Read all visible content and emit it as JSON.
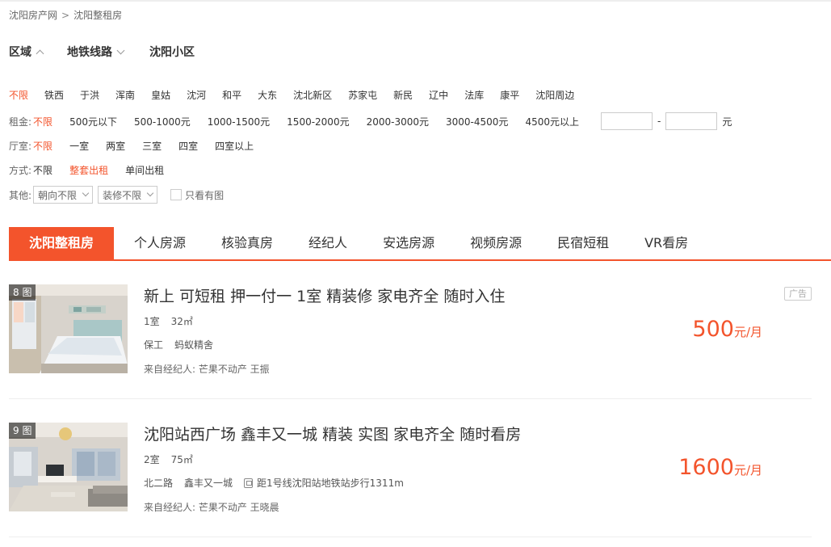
{
  "breadcrumb": {
    "home": "沈阳房产网",
    "sep": ">",
    "current": "沈阳整租房"
  },
  "search_tabs": [
    "区域",
    "地铁线路",
    "沈阳小区"
  ],
  "filters": {
    "region_options": [
      "不限",
      "铁西",
      "于洪",
      "浑南",
      "皇姑",
      "沈河",
      "和平",
      "大东",
      "沈北新区",
      "苏家屯",
      "新民",
      "辽中",
      "法库",
      "康平",
      "沈阳周边"
    ],
    "rent_label": "租金:",
    "rent_options": [
      "不限",
      "500元以下",
      "500-1000元",
      "1000-1500元",
      "1500-2000元",
      "2000-3000元",
      "3000-4500元",
      "4500元以上"
    ],
    "rent_dash": "-",
    "rent_unit": "元",
    "room_label": "厅室:",
    "room_options": [
      "不限",
      "一室",
      "两室",
      "三室",
      "四室",
      "四室以上"
    ],
    "mode_label": "方式:",
    "mode_options": [
      "不限",
      "整套出租",
      "单间出租"
    ],
    "other_label": "其他:",
    "orientation_select": "朝向不限",
    "decoration_select": "装修不限",
    "photo_only_label": "只看有图"
  },
  "main_tabs": [
    "沈阳整租房",
    "个人房源",
    "核验真房",
    "经纪人",
    "安选房源",
    "视频房源",
    "民宿短租",
    "VR看房"
  ],
  "listings": [
    {
      "photo_count": "8 图",
      "title": "新上 可短租 押一付一 1室 精装修 家电齐全 随时入住",
      "rooms": "1室",
      "area": "32㎡",
      "district": "保工",
      "community": "蚂蚁精舍",
      "subway": "",
      "agent": "来自经纪人: 芒果不动产 王振",
      "price": "500",
      "price_unit": "元/月",
      "ad_label": "广告"
    },
    {
      "photo_count": "9 图",
      "title": "沈阳站西广场 鑫丰又一城 精装 实图 家电齐全 随时看房",
      "rooms": "2室",
      "area": "75㎡",
      "district": "北二路",
      "community": "鑫丰又一城",
      "subway": "距1号线沈阳站地铁站步行1311m",
      "agent": "来自经纪人: 芒果不动产 王晓晨",
      "price": "1600",
      "price_unit": "元/月",
      "ad_label": ""
    }
  ],
  "colors": {
    "accent": "#f3542c"
  }
}
